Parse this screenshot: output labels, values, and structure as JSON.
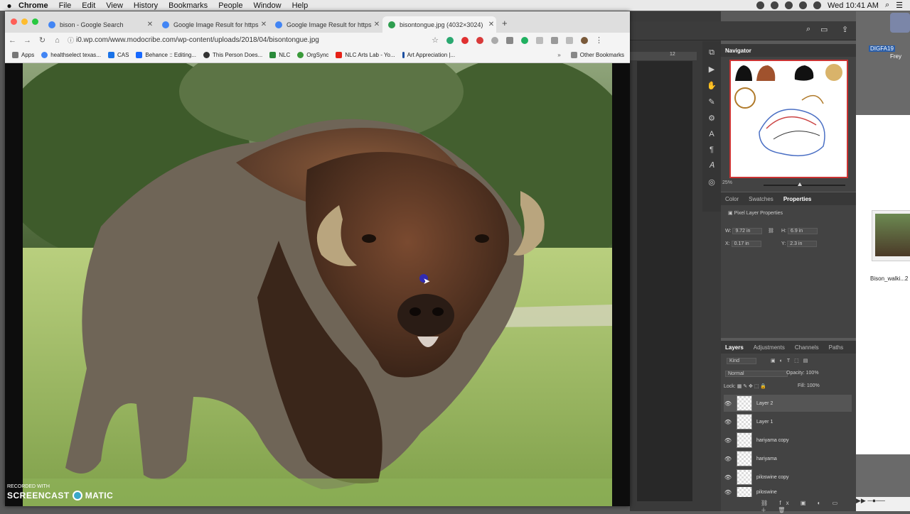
{
  "menubar": {
    "app": "Chrome",
    "items": [
      "File",
      "Edit",
      "View",
      "History",
      "Bookmarks",
      "People",
      "Window",
      "Help"
    ],
    "clock": "Wed 10:41 AM"
  },
  "browser": {
    "tabs": [
      {
        "label": "bison - Google Search",
        "color": "#4285f4"
      },
      {
        "label": "Google Image Result for https:",
        "color": "#4285f4"
      },
      {
        "label": "Google Image Result for https:",
        "color": "#4285f4"
      },
      {
        "label": "bisontongue.jpg (4032×3024)",
        "color": "#2e9e4f"
      }
    ],
    "new_tab": "+",
    "url": "i0.wp.com/www.modocribe.com/wp-content/uploads/2018/04/bisontongue.jpg",
    "bookmarks": [
      {
        "label": "Apps",
        "color": "#777"
      },
      {
        "label": "healthselect texas...",
        "color": "#4285f4"
      },
      {
        "label": "CAS",
        "color": "#1a73e8"
      },
      {
        "label": "Behance :: Editing...",
        "color": "#1769ff"
      },
      {
        "label": "This Person Does...",
        "color": "#333"
      },
      {
        "label": "NLC",
        "color": "#2a8a3a"
      },
      {
        "label": "OrgSync",
        "color": "#3a9a3a"
      },
      {
        "label": "NLC Arts Lab - Yo...",
        "color": "#e62117"
      },
      {
        "label": "Art Appreciation |...",
        "color": "#1c4fa0"
      }
    ],
    "more": "»",
    "other_bookmarks": "Other Bookmarks"
  },
  "photoshop": {
    "navigator": {
      "tab": "Navigator",
      "zoom": "25%"
    },
    "properties": {
      "tabs": [
        "Color",
        "Swatches",
        "Properties"
      ],
      "title": "Pixel Layer Properties",
      "w_label": "W:",
      "w": "9.72 in",
      "h_label": "H:",
      "h": "6.9 in",
      "x_label": "X:",
      "x": "0.17 in",
      "y_label": "Y:",
      "y": "2.3 in"
    },
    "layers": {
      "tabs": [
        "Layers",
        "Adjustments",
        "Channels",
        "Paths"
      ],
      "kind": "Kind",
      "blend": "Normal",
      "opacity_label": "Opacity:",
      "opacity": "100%",
      "lock_label": "Lock:",
      "fill_label": "Fill:",
      "fill": "100%",
      "items": [
        "Layer 2",
        "Layer 1",
        "hariyama copy",
        "hariyama",
        "piloswine copy",
        "piloswine"
      ]
    },
    "ruler_mark": "12"
  },
  "desktop": {
    "disk_label": "DIGFA19",
    "disk_sub": "Frey",
    "file_label": "Bison_walki...2"
  },
  "watermark": {
    "line1": "RECORDED WITH",
    "line2": "SCREENCAST",
    "line3": "MATIC"
  }
}
